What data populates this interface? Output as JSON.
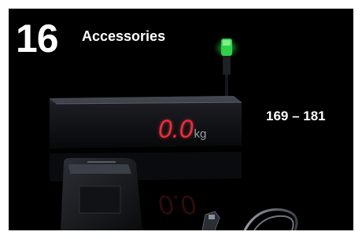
{
  "header": {
    "chapter_number": "16",
    "chapter_title": "Accessories",
    "page_range": "169 – 181"
  },
  "display": {
    "reading": "0.0",
    "unit": "kg"
  },
  "colors": {
    "background": "#000000",
    "text": "#ffffff",
    "display_red": "#e5303a",
    "signal_green": "#35e34a"
  }
}
